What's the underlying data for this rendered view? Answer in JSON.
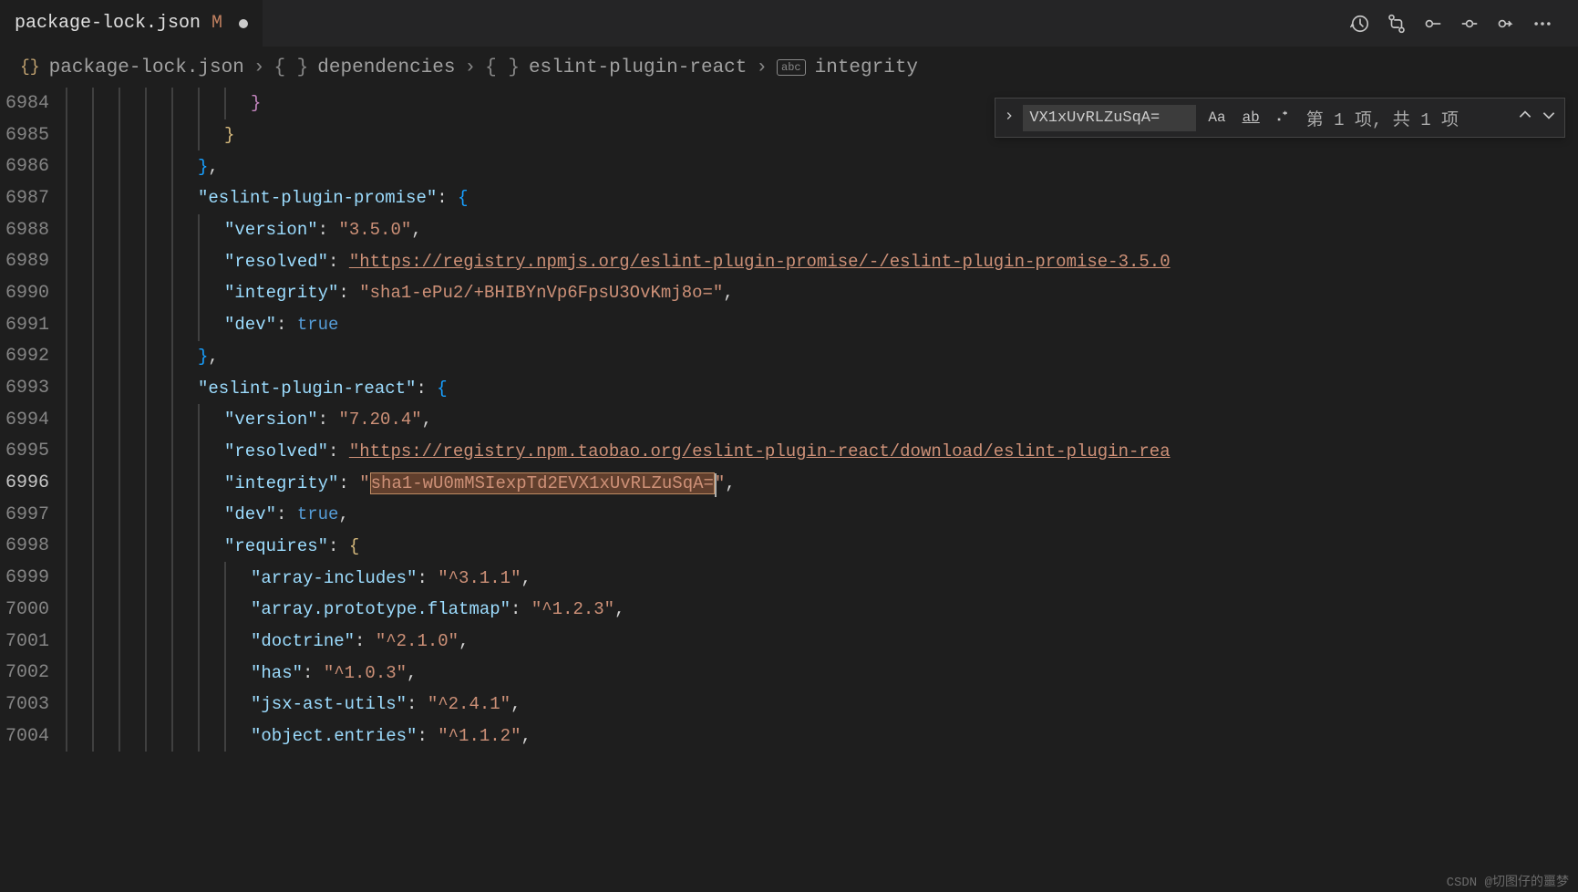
{
  "tab": {
    "title": "package-lock.json",
    "modified": "M"
  },
  "breadcrumb": {
    "file": "package-lock.json",
    "seg1": "dependencies",
    "seg2": "eslint-plugin-react",
    "seg3": "integrity"
  },
  "find": {
    "value": "VX1xUvRLZuSqA=",
    "toggle_case": "Aa",
    "toggle_word": "ab",
    "toggle_regex": ".*",
    "count": "第 1 项, 共 1 项"
  },
  "lines": {
    "start": 6984,
    "active": 6996
  },
  "code": {
    "promise_key": "\"eslint-plugin-promise\"",
    "promise_version_k": "\"version\"",
    "promise_version_v": "\"3.5.0\"",
    "promise_resolved_k": "\"resolved\"",
    "promise_resolved_v": "\"https://registry.npmjs.org/eslint-plugin-promise/-/eslint-plugin-promise-3.5.0",
    "promise_integrity_k": "\"integrity\"",
    "promise_integrity_v": "\"sha1-ePu2/+BHIBYnVp6FpsU3OvKmj8o=\"",
    "dev_k": "\"dev\"",
    "dev_v": "true",
    "react_key": "\"eslint-plugin-react\"",
    "react_version_k": "\"version\"",
    "react_version_v": "\"7.20.4\"",
    "react_resolved_k": "\"resolved\"",
    "react_resolved_v": "\"https://registry.npm.taobao.org/eslint-plugin-react/download/eslint-plugin-rea",
    "react_integrity_k": "\"integrity\"",
    "react_integrity_pre": "\"",
    "react_integrity_hl": "sha1-wU0mMSIexpTd2EVX1xUvRLZuSqA=",
    "react_integrity_post": "\"",
    "requires_k": "\"requires\"",
    "req_ai_k": "\"array-includes\"",
    "req_ai_v": "\"^3.1.1\"",
    "req_apf_k": "\"array.prototype.flatmap\"",
    "req_apf_v": "\"^1.2.3\"",
    "req_doc_k": "\"doctrine\"",
    "req_doc_v": "\"^2.1.0\"",
    "req_has_k": "\"has\"",
    "req_has_v": "\"^1.0.3\"",
    "req_jsx_k": "\"jsx-ast-utils\"",
    "req_jsx_v": "\"^2.4.1\"",
    "req_oe_k": "\"object.entries\"",
    "req_oe_v": "\"^1.1.2\""
  },
  "watermark": "CSDN @切图仔的噩梦"
}
